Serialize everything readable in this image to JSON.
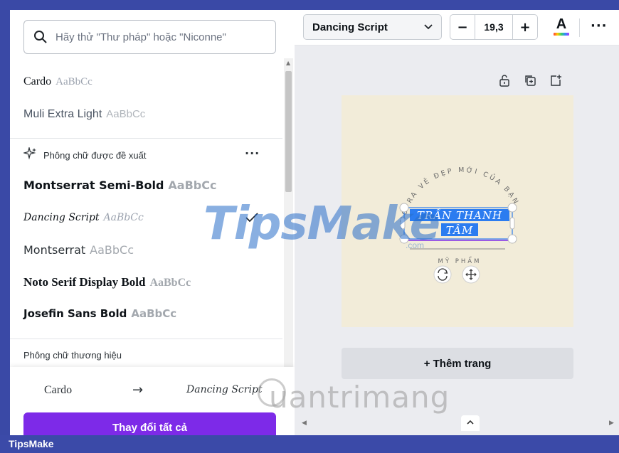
{
  "search": {
    "placeholder": "Hãy thử \"Thư pháp\" hoặc \"Niconne\""
  },
  "recent_fonts": [
    {
      "name": "Cardo",
      "sample": "AaBbCc"
    },
    {
      "name": "Muli Extra Light",
      "sample": "AaBbCc"
    }
  ],
  "suggested": {
    "heading": "Phông chữ được đề xuất",
    "more": "···",
    "fonts": [
      {
        "name": "Montserrat Semi-Bold",
        "sample": "AaBbCc"
      },
      {
        "name": "Dancing Script",
        "sample": "AaBbCc",
        "selected": true
      },
      {
        "name": "Montserrat",
        "sample": "AaBbCc"
      },
      {
        "name": "Noto Serif Display Bold",
        "sample": "AaBbCc"
      },
      {
        "name": "Josefin Sans Bold",
        "sample": "AaBbCc"
      }
    ]
  },
  "brand": {
    "heading": "Phông chữ thương hiệu"
  },
  "replace": {
    "from": "Cardo",
    "arrow": "→",
    "to": "Dancing Script",
    "button": "Thay đổi tất cả"
  },
  "toolbar": {
    "font": "Dancing Script",
    "size": "19,3",
    "minus": "−",
    "plus": "+",
    "color_letter": "A",
    "more": "···"
  },
  "design": {
    "arc_text": "MỞ RA VẺ ĐẸP MỚI CỦA BẠN",
    "name_line1": "TRẦN THANH",
    "name_line2": "TÂM",
    "tagline": "MỸ PHẨM"
  },
  "add_page": "+ Thêm trang",
  "watermarks": {
    "tipsmake": "TipsMake",
    "com": ".com",
    "quantri": "uantrimang"
  },
  "footer": {
    "label": "TipsMake"
  },
  "colors": {
    "accent": "#7d2ae8",
    "selection": "#2b7cf0",
    "frame": "#3a49a6",
    "page": "#f2ecd9"
  }
}
